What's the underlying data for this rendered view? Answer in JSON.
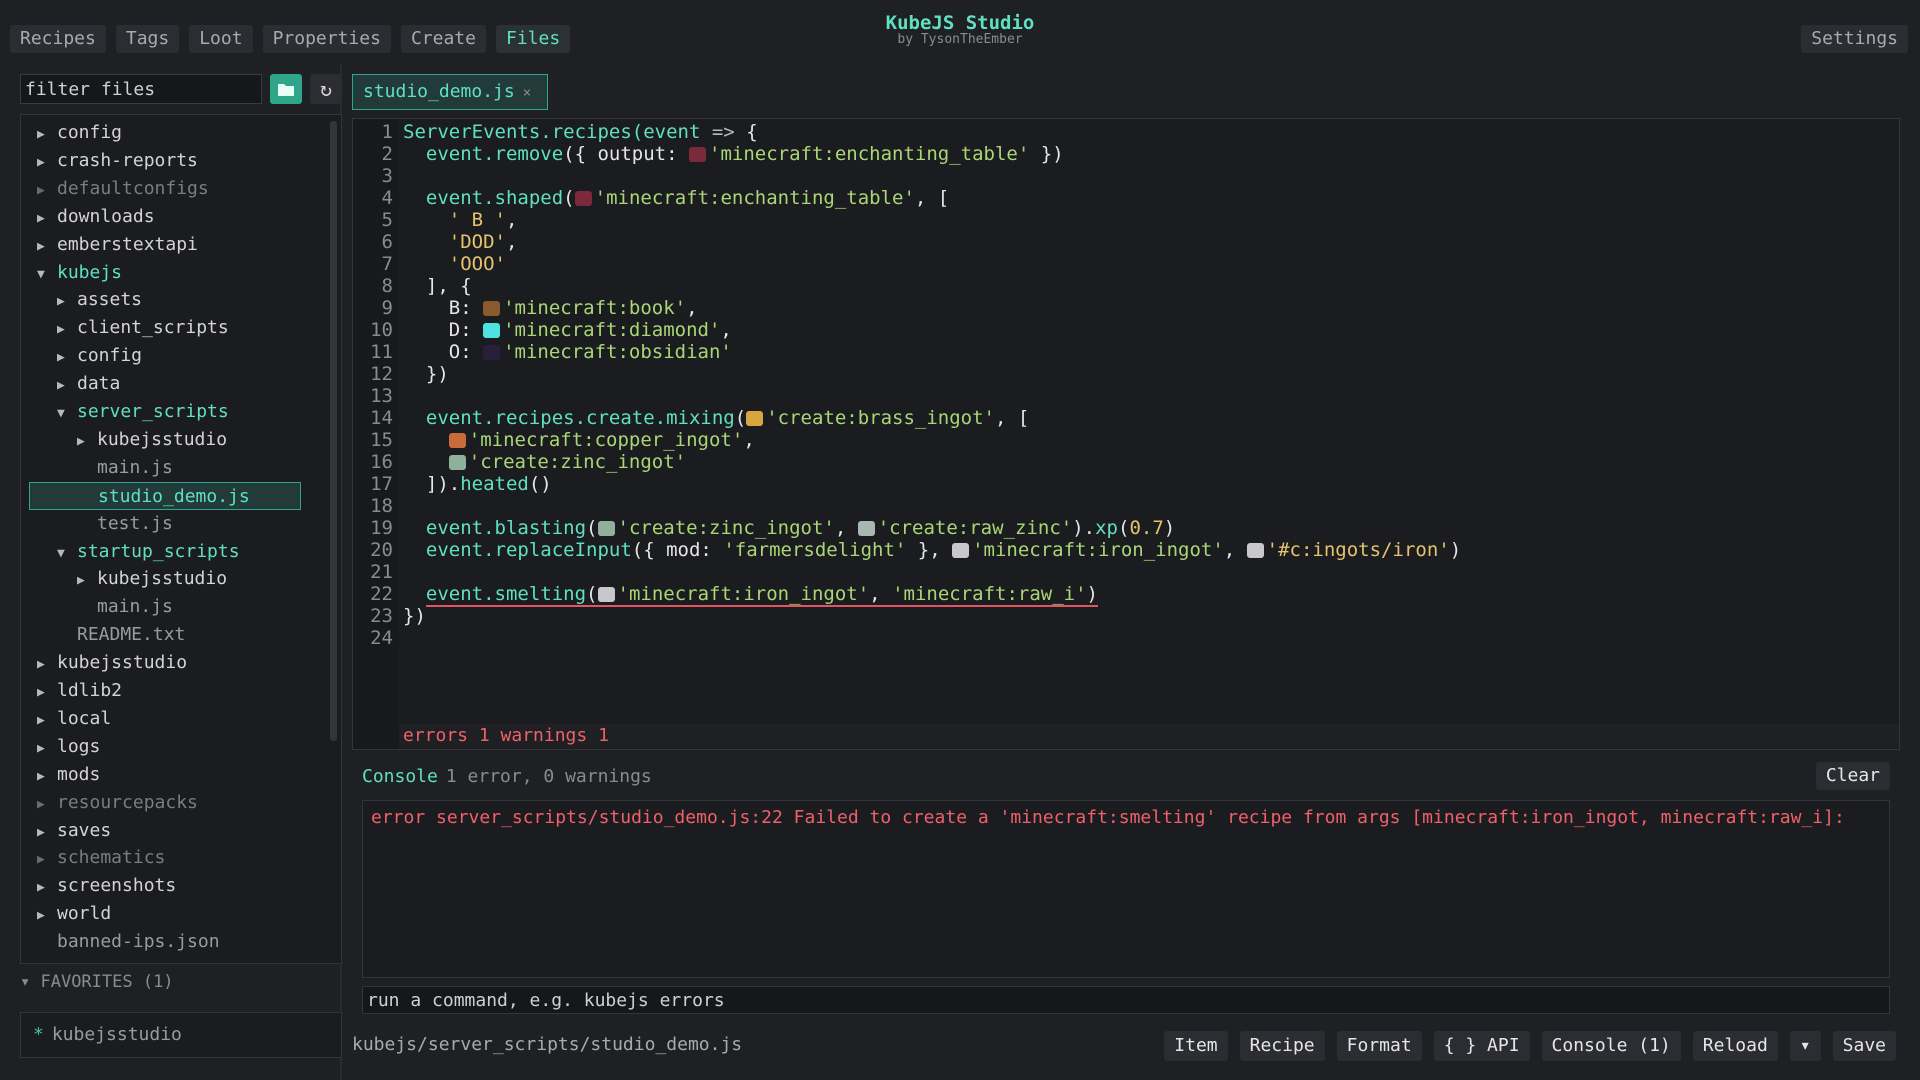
{
  "app": {
    "title": "KubeJS Studio",
    "subtitle": "by TysonTheEmber"
  },
  "top_tabs": [
    "Recipes",
    "Tags",
    "Loot",
    "Properties",
    "Create",
    "Files"
  ],
  "active_tab": "Files",
  "settings_label": "Settings",
  "sidebar": {
    "filter_placeholder": "filter files",
    "tree": [
      {
        "label": "config",
        "depth": 0,
        "kind": "folder"
      },
      {
        "label": "crash-reports",
        "depth": 0,
        "kind": "folder"
      },
      {
        "label": "defaultconfigs",
        "depth": 0,
        "kind": "folder-dim"
      },
      {
        "label": "downloads",
        "depth": 0,
        "kind": "folder"
      },
      {
        "label": "emberstextapi",
        "depth": 0,
        "kind": "folder"
      },
      {
        "label": "kubejs",
        "depth": 0,
        "kind": "folder-open"
      },
      {
        "label": "assets",
        "depth": 1,
        "kind": "folder"
      },
      {
        "label": "client_scripts",
        "depth": 1,
        "kind": "folder"
      },
      {
        "label": "config",
        "depth": 1,
        "kind": "folder"
      },
      {
        "label": "data",
        "depth": 1,
        "kind": "folder"
      },
      {
        "label": "server_scripts",
        "depth": 1,
        "kind": "folder-open"
      },
      {
        "label": "kubejsstudio",
        "depth": 2,
        "kind": "folder"
      },
      {
        "label": "main.js",
        "depth": 2,
        "kind": "file"
      },
      {
        "label": "studio_demo.js",
        "depth": 2,
        "kind": "file-selected"
      },
      {
        "label": "test.js",
        "depth": 2,
        "kind": "file"
      },
      {
        "label": "startup_scripts",
        "depth": 1,
        "kind": "folder-open"
      },
      {
        "label": "kubejsstudio",
        "depth": 2,
        "kind": "folder"
      },
      {
        "label": "main.js",
        "depth": 2,
        "kind": "file"
      },
      {
        "label": "README.txt",
        "depth": 1,
        "kind": "file"
      },
      {
        "label": "kubejsstudio",
        "depth": 0,
        "kind": "folder"
      },
      {
        "label": "ldlib2",
        "depth": 0,
        "kind": "folder"
      },
      {
        "label": "local",
        "depth": 0,
        "kind": "folder"
      },
      {
        "label": "logs",
        "depth": 0,
        "kind": "folder"
      },
      {
        "label": "mods",
        "depth": 0,
        "kind": "folder"
      },
      {
        "label": "resourcepacks",
        "depth": 0,
        "kind": "folder-dim"
      },
      {
        "label": "saves",
        "depth": 0,
        "kind": "folder"
      },
      {
        "label": "schematics",
        "depth": 0,
        "kind": "folder-dim"
      },
      {
        "label": "screenshots",
        "depth": 0,
        "kind": "folder"
      },
      {
        "label": "world",
        "depth": 0,
        "kind": "folder"
      },
      {
        "label": "banned-ips.json",
        "depth": 0,
        "kind": "plain"
      }
    ],
    "favorites_header": "FAVORITES (1)",
    "favorites": [
      "kubejsstudio"
    ]
  },
  "editor": {
    "tab_label": "studio_demo.js",
    "tab_close": "×",
    "lines": [
      [
        [
          "kw",
          "ServerEvents.recipes("
        ],
        [
          "kw",
          "event"
        ],
        [
          "pun",
          " => "
        ],
        [
          "pl",
          "{"
        ]
      ],
      [
        [
          "pl",
          "  "
        ],
        [
          "kw",
          "event.remove"
        ],
        [
          "pl",
          "({ output: "
        ],
        [
          "ico",
          "enchant"
        ],
        [
          "str",
          "'minecraft:enchanting_table'"
        ],
        [
          "pl",
          " })"
        ]
      ],
      [],
      [
        [
          "pl",
          "  "
        ],
        [
          "kw",
          "event.shaped"
        ],
        [
          "pl",
          "("
        ],
        [
          "ico",
          "enchant"
        ],
        [
          "str",
          "'minecraft:enchanting_table'"
        ],
        [
          "pl",
          ", ["
        ]
      ],
      [
        [
          "pl",
          "    "
        ],
        [
          "str-y",
          "' B '"
        ],
        [
          "pl",
          ","
        ]
      ],
      [
        [
          "pl",
          "    "
        ],
        [
          "str-y",
          "'DOD'"
        ],
        [
          "pl",
          ","
        ]
      ],
      [
        [
          "pl",
          "    "
        ],
        [
          "str-y",
          "'OOO'"
        ]
      ],
      [
        [
          "pl",
          "  ], {"
        ]
      ],
      [
        [
          "pl",
          "    B: "
        ],
        [
          "ico",
          "book"
        ],
        [
          "str",
          "'minecraft:book'"
        ],
        [
          "pl",
          ","
        ]
      ],
      [
        [
          "pl",
          "    D: "
        ],
        [
          "ico",
          "diamond"
        ],
        [
          "str",
          "'minecraft:diamond'"
        ],
        [
          "pl",
          ","
        ]
      ],
      [
        [
          "pl",
          "    O: "
        ],
        [
          "ico",
          "obsidian"
        ],
        [
          "str",
          "'minecraft:obsidian'"
        ]
      ],
      [
        [
          "pl",
          "  })"
        ]
      ],
      [],
      [
        [
          "pl",
          "  "
        ],
        [
          "kw",
          "event.recipes.create.mixing"
        ],
        [
          "pl",
          "("
        ],
        [
          "ico",
          "brass"
        ],
        [
          "str",
          "'create:brass_ingot'"
        ],
        [
          "pl",
          ", ["
        ]
      ],
      [
        [
          "pl",
          "    "
        ],
        [
          "ico",
          "copper"
        ],
        [
          "str",
          "'minecraft:copper_ingot'"
        ],
        [
          "pl",
          ","
        ]
      ],
      [
        [
          "pl",
          "    "
        ],
        [
          "ico",
          "zinc"
        ],
        [
          "str",
          "'create:zinc_ingot'"
        ]
      ],
      [
        [
          "pl",
          "  ])."
        ],
        [
          "kw",
          "heated"
        ],
        [
          "pl",
          "()"
        ]
      ],
      [],
      [
        [
          "pl",
          "  "
        ],
        [
          "kw",
          "event.blasting"
        ],
        [
          "pl",
          "("
        ],
        [
          "ico",
          "zinc"
        ],
        [
          "str",
          "'create:zinc_ingot'"
        ],
        [
          "pl",
          ", "
        ],
        [
          "ico",
          "rawzinc"
        ],
        [
          "str",
          "'create:raw_zinc'"
        ],
        [
          "pl",
          ")."
        ],
        [
          "kw",
          "xp"
        ],
        [
          "pl",
          "("
        ],
        [
          "num",
          "0.7"
        ],
        [
          "pl",
          ")"
        ]
      ],
      [
        [
          "pl",
          "  "
        ],
        [
          "kw",
          "event.replaceInput"
        ],
        [
          "pl",
          "({ mod: "
        ],
        [
          "str",
          "'farmersdelight'"
        ],
        [
          "pl",
          " }, "
        ],
        [
          "ico",
          "iron"
        ],
        [
          "str",
          "'minecraft:iron_ingot'"
        ],
        [
          "pl",
          ", "
        ],
        [
          "ico",
          "iron"
        ],
        [
          "str-y",
          "'#c:ingots/iron'"
        ],
        [
          "pl",
          ")"
        ]
      ],
      [],
      [
        [
          "pl",
          "  "
        ],
        [
          "err-start",
          ""
        ],
        [
          "kw",
          "event.smelting"
        ],
        [
          "pl",
          "("
        ],
        [
          "ico",
          "iron"
        ],
        [
          "str",
          "'minecraft:iron_ingot'"
        ],
        [
          "pl",
          ", "
        ],
        [
          "str",
          "'minecraft:raw_i'"
        ],
        [
          "pl",
          ")"
        ],
        [
          "err-end",
          ""
        ]
      ],
      [
        [
          "pl",
          "})"
        ]
      ],
      []
    ],
    "status": "errors 1  warnings 1"
  },
  "icon_colors": {
    "enchant": "#7a2a3a",
    "book": "#8a5a2e",
    "diamond": "#4fe3e0",
    "obsidian": "#2a1f3a",
    "brass": "#d8a640",
    "copper": "#c96a3a",
    "zinc": "#8fb09a",
    "rawzinc": "#a8b8b0",
    "iron": "#c8c8cc"
  },
  "console": {
    "title": "Console",
    "summary": "1 error, 0 warnings",
    "clear_label": "Clear",
    "lines": [
      "error server_scripts/studio_demo.js:22  Failed to create a 'minecraft:smelting' recipe from args [minecraft:iron_ingot, minecraft:raw_i]:"
    ],
    "command_placeholder": "run a command, e.g. kubejs errors"
  },
  "footer": {
    "path": "kubejs/server_scripts/studio_demo.js",
    "buttons": [
      "Item",
      "Recipe",
      "Format",
      "{ } API",
      "Console (1)",
      "Reload",
      "▾",
      "Save"
    ]
  }
}
